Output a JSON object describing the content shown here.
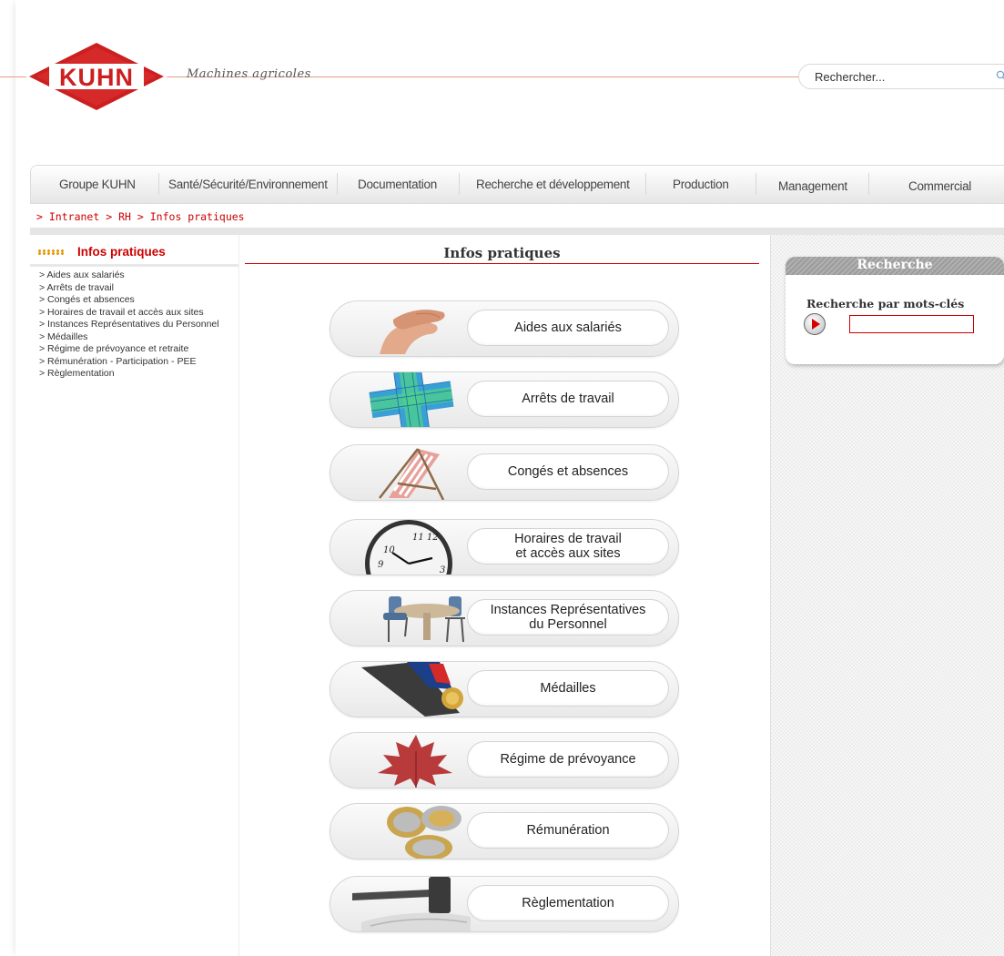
{
  "header": {
    "brand": "KUHN",
    "tagline": "Machines agricoles",
    "search_placeholder": "Rechercher..."
  },
  "nav": {
    "items": [
      "Groupe KUHN",
      "Santé/Sécurité/Environnement",
      "Documentation",
      "Recherche et développement",
      "Production",
      "Management",
      "Commercial"
    ]
  },
  "breadcrumb": {
    "items": [
      "Intranet",
      "RH",
      "Infos pratiques"
    ],
    "separator": ">"
  },
  "sidebar": {
    "title": "Infos pratiques",
    "links": [
      "> Aides aux salariés",
      "> Arrêts de travail",
      "> Congés et absences",
      "> Horaires de travail et accès aux sites",
      "> Instances Représentatives du Personnel",
      "> Médailles",
      "> Régime de prévoyance et retraite",
      "> Rémunération - Participation - PEE",
      "> Règlementation"
    ]
  },
  "main": {
    "title": "Infos pratiques",
    "tiles": [
      {
        "line1": "Aides aux salariés",
        "line2": "",
        "icon": "hands-icon"
      },
      {
        "line1": "Arrêts de travail",
        "line2": "",
        "icon": "medical-cross-icon"
      },
      {
        "line1": "Congés et absences",
        "line2": "",
        "icon": "deck-chair-icon"
      },
      {
        "line1": "Horaires de travail",
        "line2": "et accès aux sites",
        "icon": "clock-icon"
      },
      {
        "line1": "Instances Représentatives",
        "line2": "du Personnel",
        "icon": "meeting-table-icon"
      },
      {
        "line1": "Médailles",
        "line2": "",
        "icon": "medal-icon"
      },
      {
        "line1": "Régime de prévoyance",
        "line2": "",
        "icon": "maple-leaf-icon"
      },
      {
        "line1": "Rémunération",
        "line2": "",
        "icon": "coins-icon"
      },
      {
        "line1": "Règlementation",
        "line2": "",
        "icon": "gavel-icon"
      }
    ]
  },
  "search_panel": {
    "title": "Recherche",
    "label": "Recherche par mots-clés",
    "keyword_value": ""
  },
  "colors": {
    "brand_red": "#cc0000",
    "accent_orange": "#e69500",
    "nav_text": "#444444"
  }
}
